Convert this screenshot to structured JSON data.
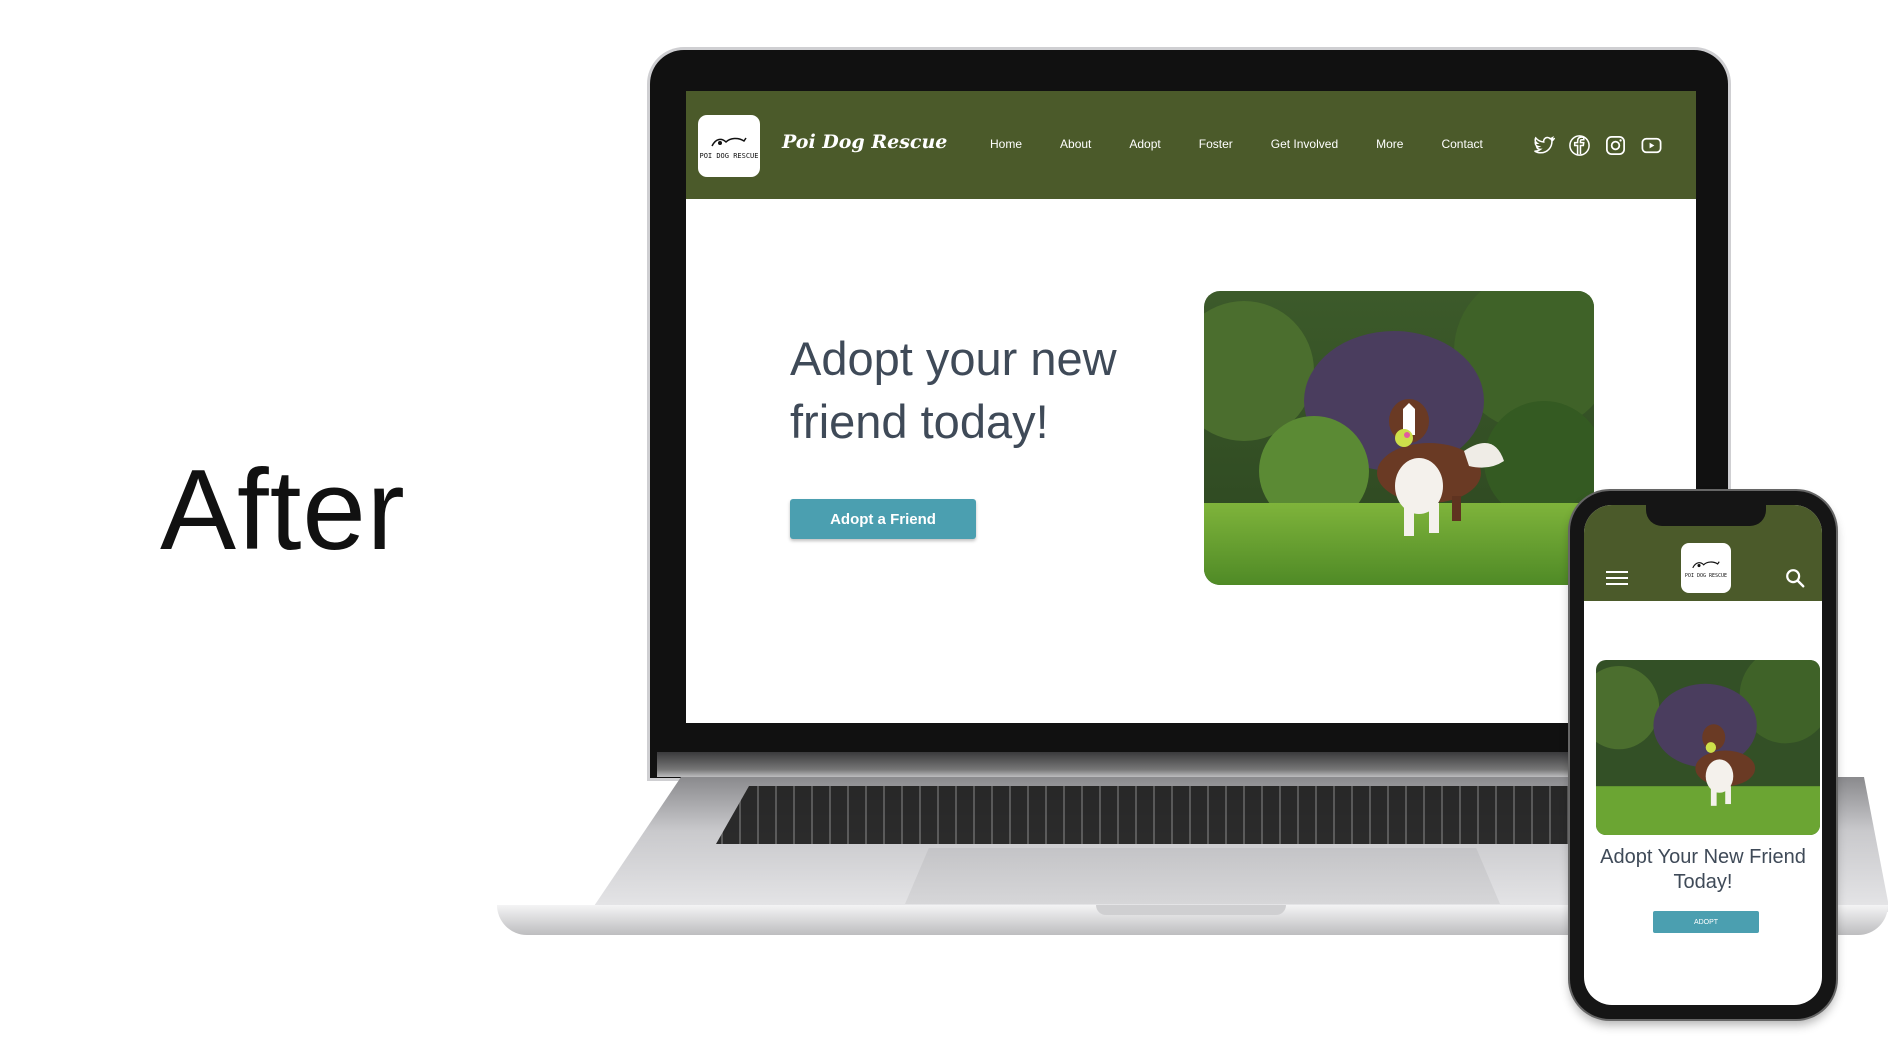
{
  "label": "After",
  "desktop": {
    "brand": "Poi Dog Rescue",
    "logo_text": "POI DOG RESCUE",
    "nav": [
      "Home",
      "About",
      "Adopt",
      "Foster",
      "Get Involved",
      "More",
      "Contact"
    ],
    "social_icons": [
      "twitter-icon",
      "facebook-icon",
      "instagram-icon",
      "youtube-icon"
    ],
    "hero_title": "Adopt your new friend today!",
    "hero_button": "Adopt a Friend",
    "colors": {
      "nav_bg": "#4b5a2a",
      "button": "#4b9fb0",
      "heading": "#3f4a58"
    }
  },
  "mobile": {
    "logo_text": "POI DOG RESCUE",
    "hero_title": "Adopt Your New Friend Today!",
    "hero_button": "ADOPT",
    "icons": [
      "hamburger-menu-icon",
      "search-icon"
    ]
  }
}
